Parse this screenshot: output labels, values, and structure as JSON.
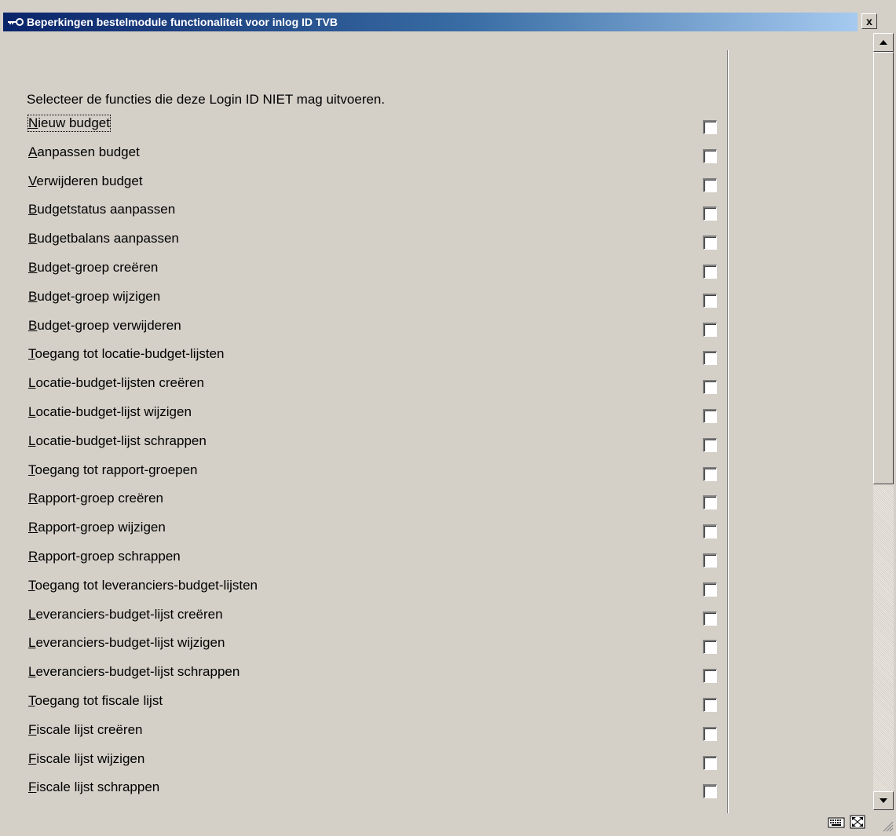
{
  "window": {
    "title": "Beperkingen bestelmodule functionaliteit voor inlog ID TVB",
    "close_label": "x"
  },
  "instruction": "Selecteer de functies die deze Login ID NIET mag uitvoeren.",
  "options": [
    {
      "first": "N",
      "rest": "ieuw budget",
      "checked": false
    },
    {
      "first": "A",
      "rest": "anpassen budget",
      "checked": false
    },
    {
      "first": "V",
      "rest": "erwijderen budget",
      "checked": false
    },
    {
      "first": "B",
      "rest": "udgetstatus aanpassen",
      "checked": false
    },
    {
      "first": "B",
      "rest": "udgetbalans aanpassen",
      "checked": false
    },
    {
      "first": "B",
      "rest": "udget-groep creëren",
      "checked": false
    },
    {
      "first": "B",
      "rest": "udget-groep wijzigen",
      "checked": false
    },
    {
      "first": "B",
      "rest": "udget-groep verwijderen",
      "checked": false
    },
    {
      "first": "T",
      "rest": "oegang tot locatie-budget-lijsten",
      "checked": false
    },
    {
      "first": "L",
      "rest": "ocatie-budget-lijsten creëren",
      "checked": false
    },
    {
      "first": "L",
      "rest": "ocatie-budget-lijst wijzigen",
      "checked": false
    },
    {
      "first": "L",
      "rest": "ocatie-budget-lijst schrappen",
      "checked": false
    },
    {
      "first": "T",
      "rest": "oegang tot rapport-groepen",
      "checked": false
    },
    {
      "first": "R",
      "rest": "apport-groep creëren",
      "checked": false
    },
    {
      "first": "R",
      "rest": "apport-groep wijzigen",
      "checked": false
    },
    {
      "first": "R",
      "rest": "apport-groep schrappen",
      "checked": false
    },
    {
      "first": "T",
      "rest": "oegang tot leveranciers-budget-lijsten",
      "checked": false
    },
    {
      "first": "L",
      "rest": "everanciers-budget-lijst creëren",
      "checked": false
    },
    {
      "first": "L",
      "rest": "everanciers-budget-lijst wijzigen",
      "checked": false
    },
    {
      "first": "L",
      "rest": "everanciers-budget-lijst schrappen",
      "checked": false
    },
    {
      "first": "T",
      "rest": "oegang tot fiscale lijst",
      "checked": false
    },
    {
      "first": "F",
      "rest": "iscale lijst creëren",
      "checked": false
    },
    {
      "first": "F",
      "rest": "iscale lijst wijzigen",
      "checked": false
    },
    {
      "first": "F",
      "rest": "iscale lijst schrappen",
      "checked": false
    }
  ],
  "icons": {
    "title": "key-icon",
    "status_left": "keyboard-icon",
    "status_right": "resize-icon",
    "grip": "size-grip-icon"
  },
  "colors": {
    "title_start": "#0a246a",
    "title_end": "#a6caf0",
    "window_bg": "#d4d0c8"
  }
}
